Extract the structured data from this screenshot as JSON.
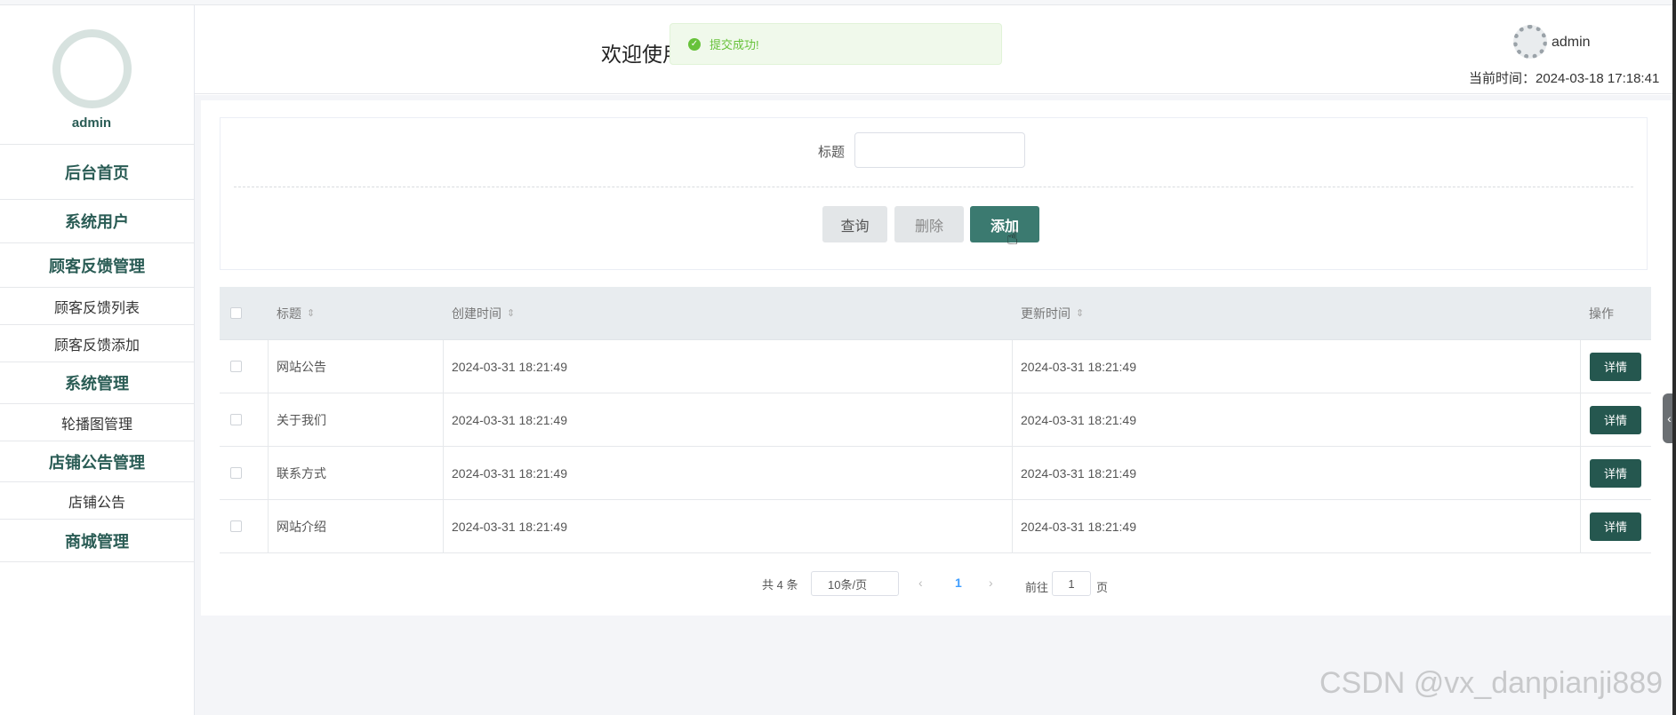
{
  "sidebar": {
    "user_name": "admin",
    "items": [
      {
        "label": "后台首页",
        "type": "main"
      },
      {
        "label": "系统用户",
        "type": "main"
      },
      {
        "label": "顾客反馈管理",
        "type": "main"
      },
      {
        "label": "顾客反馈列表",
        "type": "sub"
      },
      {
        "label": "顾客反馈添加",
        "type": "sub"
      },
      {
        "label": "系统管理",
        "type": "main"
      },
      {
        "label": "轮播图管理",
        "type": "sub"
      },
      {
        "label": "店铺公告管理",
        "type": "main"
      },
      {
        "label": "店铺公告",
        "type": "sub"
      },
      {
        "label": "商城管理",
        "type": "main"
      }
    ]
  },
  "header": {
    "welcome": "欢迎使用",
    "toast": "提交成功!",
    "user_name": "admin",
    "time_label": "当前时间：2024-03-18 17:18:41"
  },
  "search": {
    "title_label": "标题",
    "title_value": "",
    "query_label": "查询",
    "delete_label": "删除",
    "add_label": "添加"
  },
  "table": {
    "columns": [
      "标题",
      "创建时间",
      "更新时间",
      "操作"
    ],
    "detail_label": "详情",
    "rows": [
      {
        "title": "网站公告",
        "created": "2024-03-31 18:21:49",
        "updated": "2024-03-31 18:21:49"
      },
      {
        "title": "关于我们",
        "created": "2024-03-31 18:21:49",
        "updated": "2024-03-31 18:21:49"
      },
      {
        "title": "联系方式",
        "created": "2024-03-31 18:21:49",
        "updated": "2024-03-31 18:21:49"
      },
      {
        "title": "网站介绍",
        "created": "2024-03-31 18:21:49",
        "updated": "2024-03-31 18:21:49"
      }
    ]
  },
  "pagination": {
    "total": "共 4 条",
    "page_size": "10条/页",
    "current_page": "1",
    "goto_label": "前往",
    "goto_value": "1",
    "page_suffix": "页"
  },
  "watermark": "CSDN @vx_danpianji889",
  "colors": {
    "accent": "#3b7a70",
    "accent_dark": "#25574f",
    "success": "#67c23a",
    "sidebar_text": "#2a5c55"
  }
}
